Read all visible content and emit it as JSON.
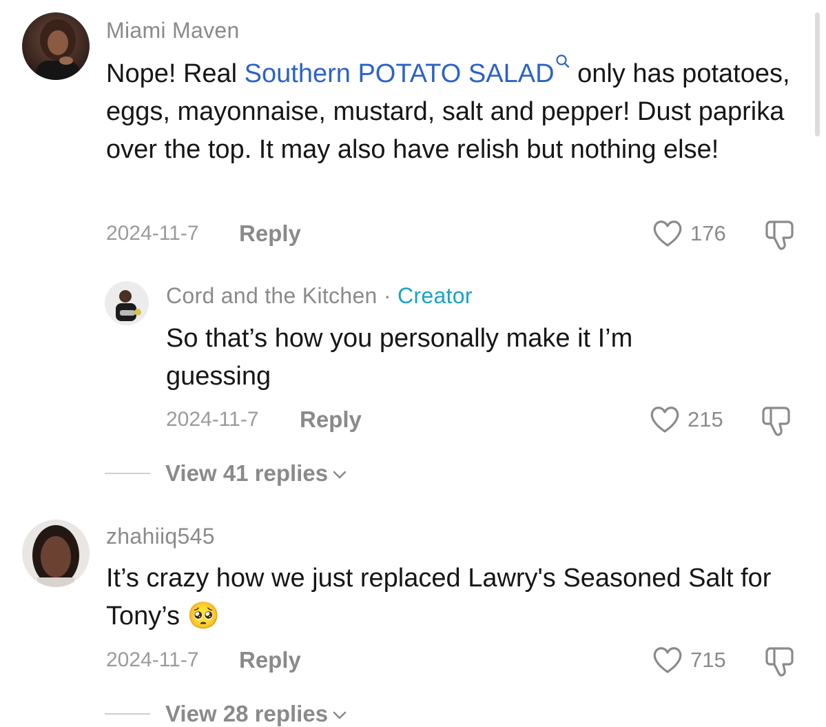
{
  "comments": [
    {
      "username": "Miami Maven",
      "text_before_link": "Nope! Real ",
      "link_text": "Southern POTATO SALAD",
      "text_after_link": " only has potatoes, eggs, mayonnaise, mustard, salt and pepper! Dust paprika over the top. It may also have relish but nothing else!",
      "date": "2024-11-7",
      "reply_label": "Reply",
      "likes": "176"
    },
    {
      "username": "Cord and the Kitchen",
      "separator": " · ",
      "creator_badge": "Creator",
      "text": "So that’s how you personally make it I’m guessing",
      "date": "2024-11-7",
      "reply_label": "Reply",
      "likes": "215"
    },
    {
      "username": "zhahiiq545",
      "text": "It’s crazy how we just replaced Lawry's Seasoned Salt for Tony’s",
      "emoji": "🥺",
      "date": "2024-11-7",
      "reply_label": "Reply",
      "likes": "715"
    }
  ],
  "view_replies": [
    {
      "label": "View 41 replies"
    },
    {
      "label": "View 28 replies"
    }
  ],
  "icons": {
    "like": "heart-outline-icon",
    "dislike": "thumbs-down-icon",
    "search": "search-icon",
    "chevron": "chevron-down-icon"
  },
  "colors": {
    "link": "#2b62c7",
    "creator": "#1aa3c4",
    "muted": "#8a8a8a"
  }
}
